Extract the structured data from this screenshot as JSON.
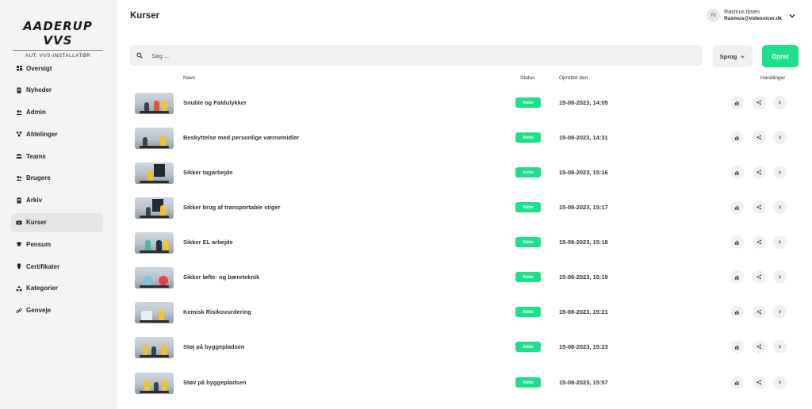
{
  "brand": {
    "name": "AADERUP VVS",
    "tagline": "AUT. VVS-INSTALLATØR"
  },
  "sidebar": {
    "items": [
      {
        "label": "Oversigt",
        "icon": "dashboard-icon",
        "active": false
      },
      {
        "label": "Nyheder",
        "icon": "news-icon",
        "active": false
      },
      {
        "label": "Admin",
        "icon": "admin-icon",
        "active": false
      },
      {
        "label": "Afdelinger",
        "icon": "departments-icon",
        "active": false
      },
      {
        "label": "Teams",
        "icon": "teams-icon",
        "active": false
      },
      {
        "label": "Brugere",
        "icon": "users-icon",
        "active": false
      },
      {
        "label": "Arkiv",
        "icon": "archive-icon",
        "active": false
      },
      {
        "label": "Kurser",
        "icon": "courses-icon",
        "active": true
      },
      {
        "label": "Pensum",
        "icon": "graduation-cap-icon",
        "active": false
      },
      {
        "label": "Certifikater",
        "icon": "certificate-icon",
        "active": false
      },
      {
        "label": "Kategorier",
        "icon": "categories-icon",
        "active": false
      },
      {
        "label": "Genveje",
        "icon": "link-icon",
        "active": false
      }
    ]
  },
  "header": {
    "title": "Kurser",
    "user": {
      "initials": "RI",
      "name": "Rasmus Ibsen",
      "email": "Rasmus@videovicer.dk"
    }
  },
  "toolbar": {
    "search_placeholder": "Søg ...",
    "language_label": "Sprog",
    "create_label": "Opret"
  },
  "table": {
    "columns": {
      "name": "Navn",
      "status": "Status",
      "created": "Oprettet den",
      "actions": "Handlinger"
    },
    "rows": [
      {
        "name": "Snuble og Faldulykker",
        "status": "Aktiv",
        "created": "15-08-2023, 14:05"
      },
      {
        "name": "Beskyttelse med personlige værnemidler",
        "status": "Aktiv",
        "created": "15-08-2023, 14:31"
      },
      {
        "name": "Sikker tagarbejde",
        "status": "Aktiv",
        "created": "15-08-2023, 15:16"
      },
      {
        "name": "Sikker brug af transportable stiger",
        "status": "Aktiv",
        "created": "15-08-2023, 15:17"
      },
      {
        "name": "Sikker EL arbejde",
        "status": "Aktiv",
        "created": "15-08-2023, 15:18"
      },
      {
        "name": "Sikker løfte- og bæreteknik",
        "status": "Aktiv",
        "created": "15-08-2023, 15:19"
      },
      {
        "name": "Kemisk Risikovurdering",
        "status": "Aktiv",
        "created": "15-08-2023, 15:21"
      },
      {
        "name": "Støj på byggepladsen",
        "status": "Aktiv",
        "created": "15-08-2023, 15:23"
      },
      {
        "name": "Støv på byggepladsen",
        "status": "Aktiv",
        "created": "15-08-2023, 15:57"
      }
    ]
  },
  "colors": {
    "accent": "#1ee08b",
    "sidebar_bg": "#f4f4f4",
    "input_bg": "#f1f1f1"
  }
}
